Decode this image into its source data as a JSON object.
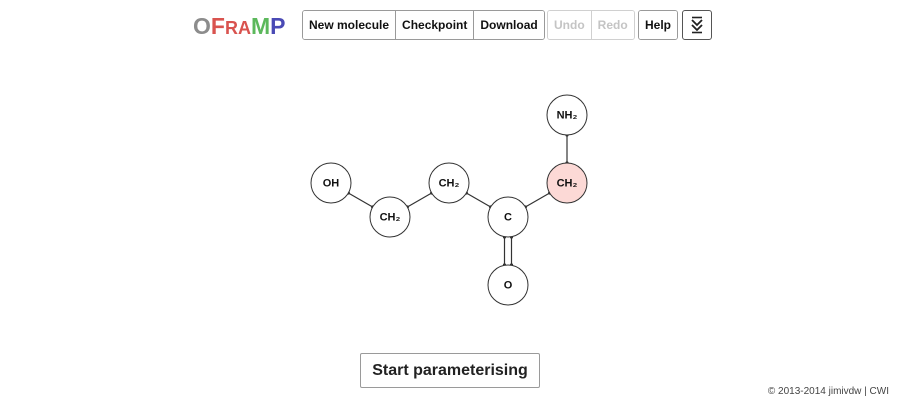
{
  "logo": {
    "letters": [
      {
        "char": "O",
        "color": "#8c8c8c"
      },
      {
        "char": "F",
        "color": "#d9534f"
      },
      {
        "char": "R",
        "color": "#d9534f"
      },
      {
        "char": "A",
        "color": "#d9534f"
      },
      {
        "char": "M",
        "color": "#5cb85c"
      },
      {
        "char": "P",
        "color": "#4a4ab5"
      }
    ]
  },
  "toolbar": {
    "new_molecule": "New molecule",
    "checkpoint": "Checkpoint",
    "download": "Download",
    "undo": "Undo",
    "redo": "Redo",
    "help": "Help",
    "menu_icon": "double-chevron-down-icon"
  },
  "molecule": {
    "atoms": [
      {
        "id": "a1",
        "label": "OH",
        "selected": false
      },
      {
        "id": "a2",
        "label": "CH₂",
        "selected": false
      },
      {
        "id": "a3",
        "label": "CH₂",
        "selected": false
      },
      {
        "id": "a4",
        "label": "C",
        "selected": false
      },
      {
        "id": "a5",
        "label": "CH₂",
        "selected": true
      },
      {
        "id": "a6",
        "label": "NH₂",
        "selected": false
      },
      {
        "id": "a7",
        "label": "O",
        "selected": false
      }
    ],
    "bonds": [
      {
        "from": "a1",
        "to": "a2",
        "order": 1
      },
      {
        "from": "a2",
        "to": "a3",
        "order": 1
      },
      {
        "from": "a3",
        "to": "a4",
        "order": 1
      },
      {
        "from": "a4",
        "to": "a5",
        "order": 1
      },
      {
        "from": "a5",
        "to": "a6",
        "order": 1
      },
      {
        "from": "a4",
        "to": "a7",
        "order": 2
      }
    ]
  },
  "actions": {
    "start": "Start parameterising"
  },
  "footer": {
    "copyright": "© 2013-2014 jimivdw | CWI"
  },
  "colors": {
    "selected_atom": "#fcd9d6",
    "border": "#9a9a9a",
    "disabled_text": "#c4c4c4"
  }
}
